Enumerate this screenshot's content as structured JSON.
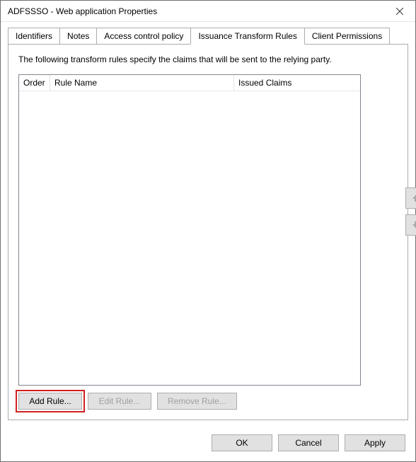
{
  "window": {
    "title": "ADFSSSO - Web application Properties"
  },
  "tabs": [
    {
      "label": "Identifiers",
      "active": false
    },
    {
      "label": "Notes",
      "active": false
    },
    {
      "label": "Access control policy",
      "active": false
    },
    {
      "label": "Issuance Transform Rules",
      "active": true
    },
    {
      "label": "Client Permissions",
      "active": false
    }
  ],
  "panel": {
    "description": "The following transform rules specify the claims that will be sent to the relying party.",
    "columns": {
      "order": "Order",
      "name": "Rule Name",
      "claims": "Issued Claims"
    },
    "rows": []
  },
  "ruleButtons": {
    "add": "Add Rule...",
    "edit": "Edit Rule...",
    "remove": "Remove Rule..."
  },
  "dialogButtons": {
    "ok": "OK",
    "cancel": "Cancel",
    "apply": "Apply"
  }
}
